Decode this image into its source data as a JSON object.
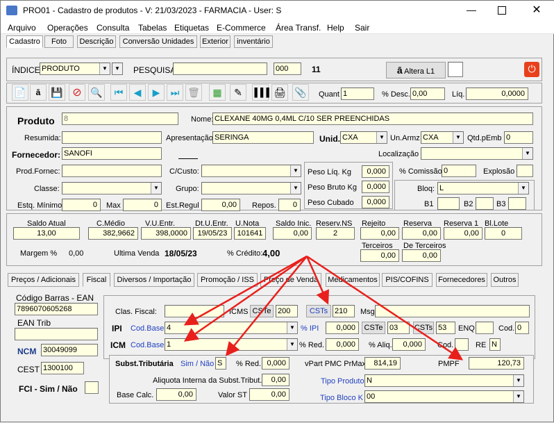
{
  "window": {
    "title": "PRO01 - Cadastro de produtos - V: 21/03/2023 - FARMACIA - User: S"
  },
  "menu": [
    "Arquivo",
    "Operações",
    "Consulta",
    "Tabelas",
    "Etiquetas",
    "E-Commerce",
    "Área Transf.",
    "Help",
    "Sair"
  ],
  "top_tabs": [
    "Cadastro",
    "Foto",
    "Descrição",
    "Conversão Unidades",
    "Exterior",
    "inventário"
  ],
  "search": {
    "indice_label": "ÍNDICE",
    "indice_value": "PRODUTO",
    "pesquisa_label": "PESQUISA",
    "pesquisa_value": "",
    "code": "000",
    "count": "11",
    "altera_label": "Altera L1"
  },
  "toolbar": {
    "quant_label": "Quant",
    "quant_value": "1",
    "desc_label": "% Desc.",
    "desc_value": "0,00",
    "liq_label": "Líq.",
    "liq_value": "0,0000"
  },
  "produto": {
    "label": "Produto",
    "code": "8",
    "nome_label": "Nome:",
    "nome": "CLEXANE 40MG 0,4ML C/10 SER PREENCHIDAS",
    "resumida_label": "Resumida:",
    "resumida": "",
    "apresentacao_label": "Apresentação",
    "apresentacao": "SERINGA",
    "unid_label": "Unid.",
    "unid": "CXA",
    "unarmz_label": "Un.Armz",
    "unarmz": "CXA",
    "qtdemb_label": "Qtd.pEmb",
    "qtdemb": "0",
    "fornecedor_label": "Fornecedor:",
    "fornecedor": "SANOFI",
    "localizacao_label": "Localização",
    "localizacao": "",
    "prodfornec_label": "Prod.Fornec:",
    "prodfornec": "",
    "custo_label": "C/Custo:",
    "custo": "",
    "pesoliq_label": "Peso Líq. Kg",
    "pesoliq": "0,000",
    "comissao_label": "% Comissão",
    "comissao": "0",
    "explosao_label": "Explosão",
    "explosao": "",
    "classe_label": "Classe:",
    "classe": "",
    "grupo_label": "Grupo:",
    "grupo": "",
    "pesobruto_label": "Peso Bruto Kg",
    "pesobruto": "0,000",
    "bloq_label": "Bloq:",
    "bloq": "L",
    "estqmin_label": "Estq. Mínimo",
    "estqmin": "0",
    "max_label": "Max",
    "max": "0",
    "estregul_label": "Est.Regul",
    "estregul": "0,00",
    "repos_label": "Repos.",
    "repos": "0",
    "pesocubado_label": "Peso Cubado",
    "pesocubado": "0,000",
    "b1_label": "B1",
    "b1": "",
    "b2_label": "B2",
    "b2": "",
    "b3_label": "B3",
    "b3": ""
  },
  "saldo": {
    "headers": [
      "Saldo Atual",
      "C.Médio",
      "V.U.Entr.",
      "Dt.U.Entr.",
      "U.Nota",
      "Saldo Inic.",
      "Reserv.NS"
    ],
    "values": [
      "13,00",
      "382,9662",
      "398,0000",
      "19/05/23",
      "101641",
      "0,00",
      "2"
    ],
    "headers2": [
      "Rejeito",
      "Reserva",
      "Reserva 1",
      "Bl.Lote"
    ],
    "values2": [
      "0,00",
      "0,00",
      "0,00",
      "0"
    ],
    "headers3": [
      "Terceiros",
      "De Terceiros"
    ],
    "values3": [
      "0,00",
      "0,00"
    ],
    "margem_label": "Margem  %",
    "margem": "0,00",
    "ultima_label": "Ultima Venda",
    "ultima": "18/05/23",
    "credito_label": "% Crédito:",
    "credito": "4,00"
  },
  "fiscal_tabs": [
    "Preços / Adicionais",
    "Fiscal",
    "Diversos / Importação",
    "Promoção / ISS",
    "Preço de Venda",
    "Medicamentos",
    "PIS/COFINS",
    "Fornecedores",
    "Outros"
  ],
  "fiscal": {
    "barras_label": "Código Barras - EAN",
    "barras": "7896070605268",
    "eantrib_label": "EAN Trib",
    "eantrib": "",
    "ncm_label": "NCM",
    "ncm": "30049099",
    "cest_label": "CEST",
    "cest": "1300100",
    "fci_label": "FCI - Sim / Não",
    "fci": "",
    "clasfiscal_label": "Clas. Fiscal:",
    "clasfiscal": "",
    "icms_label": "ICMS",
    "cste_label": "CSTe",
    "cste": "200",
    "csts_label": "CSTs",
    "csts": "210",
    "msg_label": "Msg",
    "msg": "",
    "ipi_label": "IPI",
    "ipi_codbase_label": "Cod.Base",
    "ipi_codbase": "4",
    "pct_ipi_label": "% IPI",
    "pct_ipi": "0,000",
    "ipi_cste_label": "CSTe",
    "ipi_cste": "03",
    "ipi_csts_label": "CSTs",
    "ipi_csts": "53",
    "enq_label": "ENQ",
    "enq": "",
    "cod_label": "Cod.",
    "cod": "0",
    "icm_label": "ICM",
    "icm_codbase_label": "Cod.Base",
    "icm_codbase": "1",
    "red_label": "% Red.",
    "red": "0,000",
    "aliq_label": "% Aliq.",
    "aliq": "0,000",
    "cod2_label": "Cod.",
    "cod2": "",
    "re_label": "RE",
    "re": "N",
    "subst_label": "Subst.Tributária",
    "simnao_label": "Sim / Não",
    "simnao": "S",
    "subst_red_label": "% Red.",
    "subst_red": "0,000",
    "vpart_label": "vPart PMC PrMax",
    "vpart": "814,19",
    "pmpf_label": "PMPF",
    "pmpf": "120,73",
    "aliqint_label": "Aliquota Interna da Subst.Tribut.",
    "aliqint": "0,00",
    "tipoproduto_label": "Tipo Produto",
    "tipoproduto": "N",
    "basecalc_label": "Base Calc.",
    "basecalc": "0,00",
    "valorst_label": "Valor ST",
    "valorst": "0,00",
    "tipobloco_label": "Tipo Bloco K",
    "tipobloco": "00"
  },
  "colors": {
    "accent": "#1f3fbf",
    "field_yellow": "#ffffe1",
    "arrow": "#e8201c",
    "power": "#e8401c"
  }
}
